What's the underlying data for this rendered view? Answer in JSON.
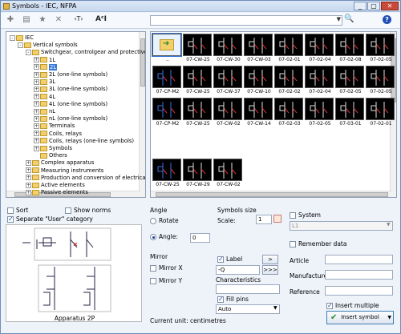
{
  "window": {
    "title": "Symbols - IEC, NFPA"
  },
  "titlebar": {
    "minimize": "_",
    "maximize": "▢",
    "close": "✕"
  },
  "toolbar": {
    "search_placeholder": "",
    "text_tool": "‹T›",
    "font_tool": "AᶜI"
  },
  "tree": {
    "items": [
      {
        "label": "IEC",
        "level": 0,
        "exp": "-"
      },
      {
        "label": "Vertical symbols",
        "level": 1,
        "exp": "-"
      },
      {
        "label": "Switchgear, controlgear and protective de",
        "level": 2,
        "exp": "-"
      },
      {
        "label": "1L",
        "level": 3,
        "exp": "+"
      },
      {
        "label": "2L",
        "level": 3,
        "exp": "+",
        "selected": true
      },
      {
        "label": "2L (one-line symbols)",
        "level": 3,
        "exp": "+"
      },
      {
        "label": "3L",
        "level": 3,
        "exp": "+"
      },
      {
        "label": "3L (one-line symbols)",
        "level": 3,
        "exp": "+"
      },
      {
        "label": "4L",
        "level": 3,
        "exp": "+"
      },
      {
        "label": "4L (one-line symbols)",
        "level": 3,
        "exp": "+"
      },
      {
        "label": "nL",
        "level": 3,
        "exp": "+"
      },
      {
        "label": "nL (one-line symbols)",
        "level": 3,
        "exp": "+"
      },
      {
        "label": "Terminals",
        "level": 3,
        "exp": "+"
      },
      {
        "label": "Coils, relays",
        "level": 3,
        "exp": "+"
      },
      {
        "label": "Coils, relays (one-line symbols)",
        "level": 3,
        "exp": "+"
      },
      {
        "label": "Symbols",
        "level": 3,
        "exp": "+"
      },
      {
        "label": "Others",
        "level": 3,
        "exp": ""
      },
      {
        "label": "Complex apparatus",
        "level": 2,
        "exp": "+"
      },
      {
        "label": "Measuring instruments",
        "level": 2,
        "exp": "+"
      },
      {
        "label": "Production and conversion of electrical ene",
        "level": 2,
        "exp": "+"
      },
      {
        "label": "Active elements",
        "level": 2,
        "exp": "+"
      },
      {
        "label": "Passive elements",
        "level": 2,
        "exp": "+"
      }
    ]
  },
  "symbols": {
    "rows": [
      [
        "..",
        "07-CW-25",
        "07-CW-30",
        "07-CW-03",
        "07-02-01",
        "07-02-04",
        "07-02-08",
        "07-02-05"
      ],
      [
        "07-CP-M2",
        "07-CW-25",
        "07-CW-37",
        "07-CW-10",
        "07-02-02",
        "07-02-04",
        "07-02-05",
        "07-02-05"
      ],
      [
        "07-CP-M2",
        "07-CW-25",
        "07-CW-02",
        "07-CW-14",
        "07-02-03",
        "07-02-05",
        "07-03-01",
        "07-02-01"
      ],
      [
        "07-CW-25",
        "07-CW-29",
        "07-CW-02"
      ]
    ]
  },
  "options": {
    "sort": "Sort",
    "show_norms": "Show norms",
    "separate_user": "Separate \"User\" category"
  },
  "angle": {
    "heading": "Angle",
    "rotate": "Rotate",
    "angle_label": "Angle:",
    "angle_value": "0"
  },
  "symbols_size": {
    "heading": "Symbols size",
    "scale_label": "Scale:",
    "scale_value": "1"
  },
  "system": {
    "label": "System",
    "value": "L1"
  },
  "remember_data": "Remember data",
  "mirror": {
    "heading": "Mirror",
    "mirror_x": "Mirror X",
    "mirror_y": "Mirror Y"
  },
  "label": {
    "checkbox": "Label",
    "value": "-Q",
    "btn_next": ">",
    "btn_more": ">>>"
  },
  "characteristics": {
    "label": "Characteristics",
    "value": ""
  },
  "article": {
    "label": "Article",
    "value": ""
  },
  "manufacturer": {
    "label": "Manufacturer",
    "value": ""
  },
  "reference": {
    "label": "Reference",
    "value": ""
  },
  "fill_pins": {
    "checkbox": "Fill pins",
    "value": "Auto"
  },
  "insert_multiple": "Insert multiple",
  "insert_symbol": "Insert symbol",
  "current_unit": "Current unit: centimetres",
  "preview": {
    "caption": "Apparatus 2P"
  },
  "colors": {
    "accent": "#3878d8",
    "thumb_bg": "#000000",
    "folder": "#f2cf6a"
  }
}
